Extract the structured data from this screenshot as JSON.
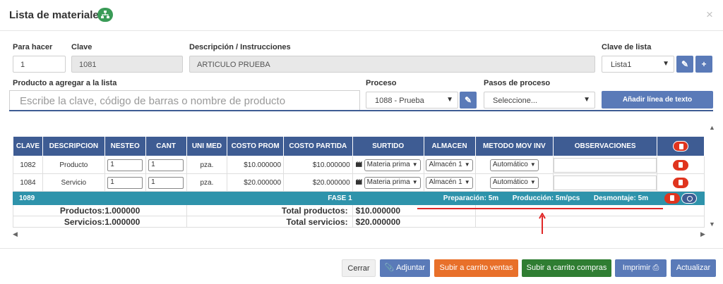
{
  "header": {
    "title": "Lista de materiales",
    "close": "×"
  },
  "form": {
    "labels": {
      "para_hacer": "Para hacer",
      "clave": "Clave",
      "descripcion": "Descripción / Instrucciones",
      "clave_lista": "Clave de lista",
      "producto": "Producto a agregar a la lista",
      "proceso": "Proceso",
      "pasos": "Pasos de proceso"
    },
    "values": {
      "para_hacer": "1",
      "clave": "1081",
      "descripcion": "ARTICULO PRUEBA",
      "clave_lista": "Lista1",
      "proceso": "1088 - Prueba",
      "pasos": "Seleccione..."
    },
    "search_placeholder": "Escribe la clave, código de barras o nombre de producto",
    "add_text_button": "Añadir línea de texto"
  },
  "table": {
    "columns": [
      "CLAVE",
      "DESCRIPCION",
      "NESTEO",
      "CANT",
      "UNI MED",
      "COSTO PROM",
      "COSTO PARTIDA",
      "SURTIDO",
      "ALMACEN",
      "METODO MOV INV",
      "OBSERVACIONES"
    ],
    "rows": [
      {
        "clave": "1082",
        "descripcion": "Producto",
        "nesteo": "1",
        "cant": "1",
        "uni_med": "pza.",
        "costo_prom": "$10.000000",
        "costo_partida": "$10.000000",
        "surtido": "Materia prima",
        "almacen": "Almacén 1",
        "metodo": "Automático"
      },
      {
        "clave": "1084",
        "descripcion": "Servicio",
        "nesteo": "1",
        "cant": "1",
        "uni_med": "pza.",
        "costo_prom": "$20.000000",
        "costo_partida": "$20.000000",
        "surtido": "Materia prima",
        "almacen": "Almacén 1",
        "metodo": "Automático"
      }
    ],
    "phase": {
      "clave": "1089",
      "label": "FASE 1",
      "preparacion": "Preparación: 5m",
      "produccion": "Producción: 5m/pcs",
      "desmontaje": "Desmontaje: 5m"
    },
    "totals": [
      {
        "label": "Productos:",
        "qty": "1.000000",
        "total_label": "Total productos:",
        "total": "$10.000000"
      },
      {
        "label": "Servicios:",
        "qty": "1.000000",
        "total_label": "Total servicios:",
        "total": "$20.000000"
      }
    ]
  },
  "footer": {
    "cerrar": "Cerrar",
    "adjuntar": "Adjuntar",
    "carrito_ventas": "Subir a carrito ventas",
    "carrito_compras": "Subir a carrito compras",
    "imprimir": "Imprimir",
    "actualizar": "Actualizar"
  },
  "colors": {
    "primary": "#3e5c93",
    "button": "#5a7ab8",
    "phase": "#2e93ab",
    "danger": "#e0341e",
    "orange": "#e8702a",
    "green": "#2f7d32",
    "annotation": "#e02727"
  }
}
